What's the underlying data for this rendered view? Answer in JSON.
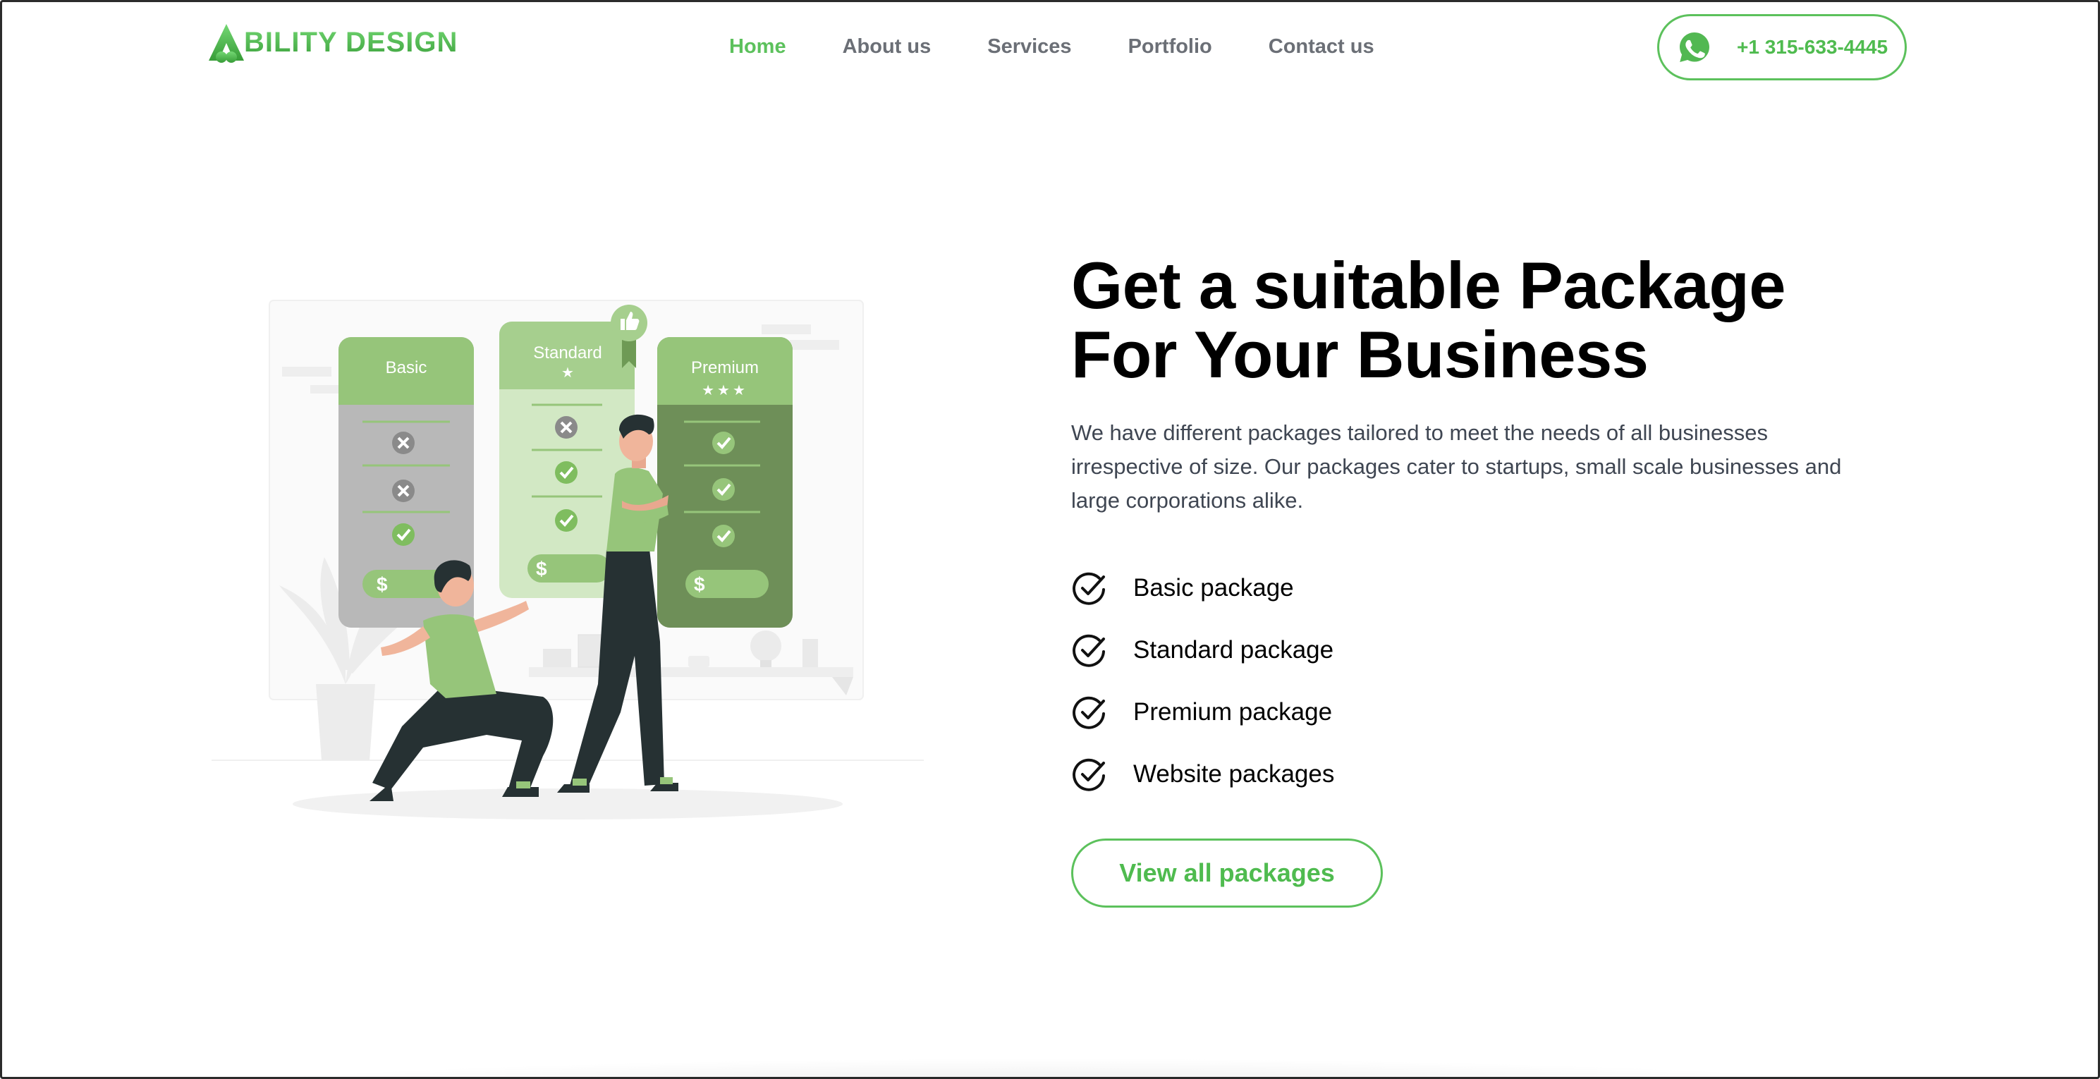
{
  "brand": {
    "name": "BILITY DESIGN",
    "color": "#5cc15c"
  },
  "nav": {
    "items": [
      {
        "label": "Home",
        "active": true
      },
      {
        "label": "About us",
        "active": false
      },
      {
        "label": "Services",
        "active": false
      },
      {
        "label": "Portfolio",
        "active": false
      },
      {
        "label": "Contact us",
        "active": false
      }
    ],
    "phone": {
      "icon": "whatsapp-icon",
      "number": "+1 315-633-4445"
    }
  },
  "illustration": {
    "cards": [
      {
        "title": "Basic",
        "stars": 0
      },
      {
        "title": "Standard",
        "stars": 1
      },
      {
        "title": "Premium",
        "stars": 3
      }
    ],
    "price_symbol": "$"
  },
  "hero": {
    "title_line1": "Get a suitable Package",
    "title_line2": "For Your Business",
    "description": "We have different packages tailored to meet the needs of all businesses irrespective of size. Our packages cater to startups, small scale businesses and large corporations alike.",
    "features": [
      "Basic package",
      "Standard package",
      "Premium package",
      "Website packages"
    ],
    "cta_label": "View all packages"
  }
}
